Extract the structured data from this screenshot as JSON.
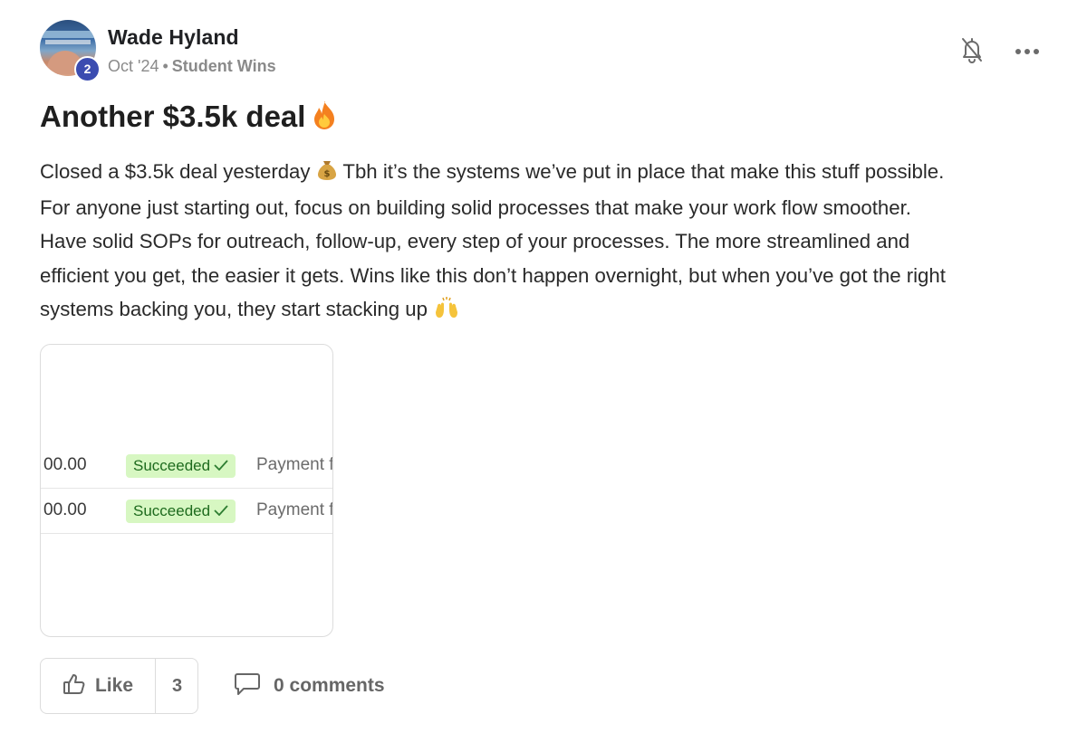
{
  "post": {
    "author": {
      "name": "Wade Hyland",
      "level": "2"
    },
    "meta": {
      "date": "Oct '24",
      "separator": "•",
      "category": "Student Wins"
    },
    "title": "Another $3.5k deal",
    "title_emoji": "fire-emoji",
    "body_lines": [
      [
        "Closed a $3.5k deal yesterday ",
        "money-bag-emoji",
        " Tbh it’s the systems we’ve put in place that make this stuff possible."
      ],
      "For anyone just starting out, focus on building solid processes that make your work flow smoother.",
      "Have solid SOPs for outreach, follow-up, every step of your processes. The more streamlined and",
      "efficient you get, the easier it gets. Wins like this don’t happen overnight, but when you’ve got the right",
      [
        "systems backing you, they start stacking up ",
        "raising-hands-emoji",
        ""
      ]
    ],
    "attachment": {
      "rows": [
        {
          "amount": "00.00",
          "status": "Succeeded",
          "status_icon": "check-icon",
          "description": "Payment f"
        },
        {
          "amount": "00.00",
          "status": "Succeeded",
          "status_icon": "check-icon",
          "description": "Payment f"
        }
      ],
      "status_bg": "#d7f7c2",
      "status_fg": "#1e6b1e"
    },
    "actions": {
      "like_label": "Like",
      "like_count": "3",
      "comments_label": "0 comments"
    },
    "icons": {
      "notification": "bell-off-icon",
      "menu": "more-horizontal-icon",
      "like": "thumbs-up-icon",
      "comment": "comment-bubble-icon"
    },
    "colors": {
      "level_badge": "#3b4cb0",
      "muted_text": "#8a8a8a"
    }
  }
}
